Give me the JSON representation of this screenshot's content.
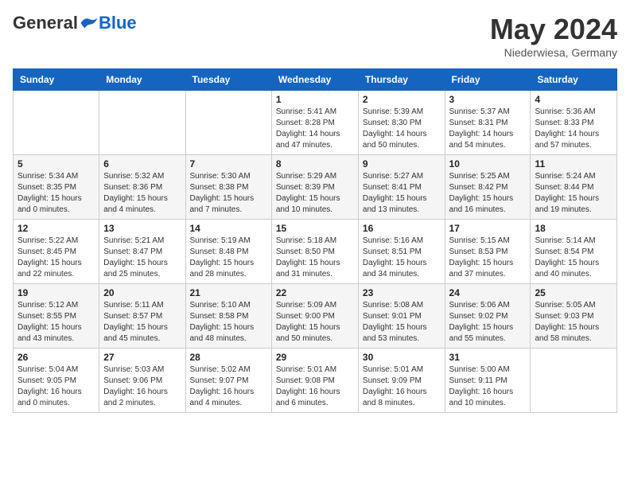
{
  "logo": {
    "general": "General",
    "blue": "Blue"
  },
  "title": "May 2024",
  "subtitle": "Niederwiesa, Germany",
  "days_header": [
    "Sunday",
    "Monday",
    "Tuesday",
    "Wednesday",
    "Thursday",
    "Friday",
    "Saturday"
  ],
  "weeks": [
    [
      {
        "day": "",
        "info": ""
      },
      {
        "day": "",
        "info": ""
      },
      {
        "day": "",
        "info": ""
      },
      {
        "day": "1",
        "info": "Sunrise: 5:41 AM\nSunset: 8:28 PM\nDaylight: 14 hours\nand 47 minutes."
      },
      {
        "day": "2",
        "info": "Sunrise: 5:39 AM\nSunset: 8:30 PM\nDaylight: 14 hours\nand 50 minutes."
      },
      {
        "day": "3",
        "info": "Sunrise: 5:37 AM\nSunset: 8:31 PM\nDaylight: 14 hours\nand 54 minutes."
      },
      {
        "day": "4",
        "info": "Sunrise: 5:36 AM\nSunset: 8:33 PM\nDaylight: 14 hours\nand 57 minutes."
      }
    ],
    [
      {
        "day": "5",
        "info": "Sunrise: 5:34 AM\nSunset: 8:35 PM\nDaylight: 15 hours\nand 0 minutes."
      },
      {
        "day": "6",
        "info": "Sunrise: 5:32 AM\nSunset: 8:36 PM\nDaylight: 15 hours\nand 4 minutes."
      },
      {
        "day": "7",
        "info": "Sunrise: 5:30 AM\nSunset: 8:38 PM\nDaylight: 15 hours\nand 7 minutes."
      },
      {
        "day": "8",
        "info": "Sunrise: 5:29 AM\nSunset: 8:39 PM\nDaylight: 15 hours\nand 10 minutes."
      },
      {
        "day": "9",
        "info": "Sunrise: 5:27 AM\nSunset: 8:41 PM\nDaylight: 15 hours\nand 13 minutes."
      },
      {
        "day": "10",
        "info": "Sunrise: 5:25 AM\nSunset: 8:42 PM\nDaylight: 15 hours\nand 16 minutes."
      },
      {
        "day": "11",
        "info": "Sunrise: 5:24 AM\nSunset: 8:44 PM\nDaylight: 15 hours\nand 19 minutes."
      }
    ],
    [
      {
        "day": "12",
        "info": "Sunrise: 5:22 AM\nSunset: 8:45 PM\nDaylight: 15 hours\nand 22 minutes."
      },
      {
        "day": "13",
        "info": "Sunrise: 5:21 AM\nSunset: 8:47 PM\nDaylight: 15 hours\nand 25 minutes."
      },
      {
        "day": "14",
        "info": "Sunrise: 5:19 AM\nSunset: 8:48 PM\nDaylight: 15 hours\nand 28 minutes."
      },
      {
        "day": "15",
        "info": "Sunrise: 5:18 AM\nSunset: 8:50 PM\nDaylight: 15 hours\nand 31 minutes."
      },
      {
        "day": "16",
        "info": "Sunrise: 5:16 AM\nSunset: 8:51 PM\nDaylight: 15 hours\nand 34 minutes."
      },
      {
        "day": "17",
        "info": "Sunrise: 5:15 AM\nSunset: 8:53 PM\nDaylight: 15 hours\nand 37 minutes."
      },
      {
        "day": "18",
        "info": "Sunrise: 5:14 AM\nSunset: 8:54 PM\nDaylight: 15 hours\nand 40 minutes."
      }
    ],
    [
      {
        "day": "19",
        "info": "Sunrise: 5:12 AM\nSunset: 8:55 PM\nDaylight: 15 hours\nand 43 minutes."
      },
      {
        "day": "20",
        "info": "Sunrise: 5:11 AM\nSunset: 8:57 PM\nDaylight: 15 hours\nand 45 minutes."
      },
      {
        "day": "21",
        "info": "Sunrise: 5:10 AM\nSunset: 8:58 PM\nDaylight: 15 hours\nand 48 minutes."
      },
      {
        "day": "22",
        "info": "Sunrise: 5:09 AM\nSunset: 9:00 PM\nDaylight: 15 hours\nand 50 minutes."
      },
      {
        "day": "23",
        "info": "Sunrise: 5:08 AM\nSunset: 9:01 PM\nDaylight: 15 hours\nand 53 minutes."
      },
      {
        "day": "24",
        "info": "Sunrise: 5:06 AM\nSunset: 9:02 PM\nDaylight: 15 hours\nand 55 minutes."
      },
      {
        "day": "25",
        "info": "Sunrise: 5:05 AM\nSunset: 9:03 PM\nDaylight: 15 hours\nand 58 minutes."
      }
    ],
    [
      {
        "day": "26",
        "info": "Sunrise: 5:04 AM\nSunset: 9:05 PM\nDaylight: 16 hours\nand 0 minutes."
      },
      {
        "day": "27",
        "info": "Sunrise: 5:03 AM\nSunset: 9:06 PM\nDaylight: 16 hours\nand 2 minutes."
      },
      {
        "day": "28",
        "info": "Sunrise: 5:02 AM\nSunset: 9:07 PM\nDaylight: 16 hours\nand 4 minutes."
      },
      {
        "day": "29",
        "info": "Sunrise: 5:01 AM\nSunset: 9:08 PM\nDaylight: 16 hours\nand 6 minutes."
      },
      {
        "day": "30",
        "info": "Sunrise: 5:01 AM\nSunset: 9:09 PM\nDaylight: 16 hours\nand 8 minutes."
      },
      {
        "day": "31",
        "info": "Sunrise: 5:00 AM\nSunset: 9:11 PM\nDaylight: 16 hours\nand 10 minutes."
      },
      {
        "day": "",
        "info": ""
      }
    ]
  ]
}
